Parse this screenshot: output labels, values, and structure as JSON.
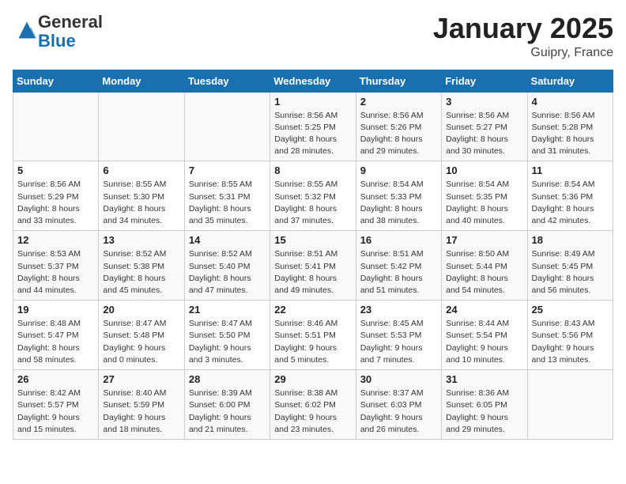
{
  "logo": {
    "general": "General",
    "blue": "Blue"
  },
  "header": {
    "month": "January 2025",
    "location": "Guipry, France"
  },
  "weekdays": [
    "Sunday",
    "Monday",
    "Tuesday",
    "Wednesday",
    "Thursday",
    "Friday",
    "Saturday"
  ],
  "weeks": [
    [
      {
        "day": "",
        "info": ""
      },
      {
        "day": "",
        "info": ""
      },
      {
        "day": "",
        "info": ""
      },
      {
        "day": "1",
        "info": "Sunrise: 8:56 AM\nSunset: 5:25 PM\nDaylight: 8 hours\nand 28 minutes."
      },
      {
        "day": "2",
        "info": "Sunrise: 8:56 AM\nSunset: 5:26 PM\nDaylight: 8 hours\nand 29 minutes."
      },
      {
        "day": "3",
        "info": "Sunrise: 8:56 AM\nSunset: 5:27 PM\nDaylight: 8 hours\nand 30 minutes."
      },
      {
        "day": "4",
        "info": "Sunrise: 8:56 AM\nSunset: 5:28 PM\nDaylight: 8 hours\nand 31 minutes."
      }
    ],
    [
      {
        "day": "5",
        "info": "Sunrise: 8:56 AM\nSunset: 5:29 PM\nDaylight: 8 hours\nand 33 minutes."
      },
      {
        "day": "6",
        "info": "Sunrise: 8:55 AM\nSunset: 5:30 PM\nDaylight: 8 hours\nand 34 minutes."
      },
      {
        "day": "7",
        "info": "Sunrise: 8:55 AM\nSunset: 5:31 PM\nDaylight: 8 hours\nand 35 minutes."
      },
      {
        "day": "8",
        "info": "Sunrise: 8:55 AM\nSunset: 5:32 PM\nDaylight: 8 hours\nand 37 minutes."
      },
      {
        "day": "9",
        "info": "Sunrise: 8:54 AM\nSunset: 5:33 PM\nDaylight: 8 hours\nand 38 minutes."
      },
      {
        "day": "10",
        "info": "Sunrise: 8:54 AM\nSunset: 5:35 PM\nDaylight: 8 hours\nand 40 minutes."
      },
      {
        "day": "11",
        "info": "Sunrise: 8:54 AM\nSunset: 5:36 PM\nDaylight: 8 hours\nand 42 minutes."
      }
    ],
    [
      {
        "day": "12",
        "info": "Sunrise: 8:53 AM\nSunset: 5:37 PM\nDaylight: 8 hours\nand 44 minutes."
      },
      {
        "day": "13",
        "info": "Sunrise: 8:52 AM\nSunset: 5:38 PM\nDaylight: 8 hours\nand 45 minutes."
      },
      {
        "day": "14",
        "info": "Sunrise: 8:52 AM\nSunset: 5:40 PM\nDaylight: 8 hours\nand 47 minutes."
      },
      {
        "day": "15",
        "info": "Sunrise: 8:51 AM\nSunset: 5:41 PM\nDaylight: 8 hours\nand 49 minutes."
      },
      {
        "day": "16",
        "info": "Sunrise: 8:51 AM\nSunset: 5:42 PM\nDaylight: 8 hours\nand 51 minutes."
      },
      {
        "day": "17",
        "info": "Sunrise: 8:50 AM\nSunset: 5:44 PM\nDaylight: 8 hours\nand 54 minutes."
      },
      {
        "day": "18",
        "info": "Sunrise: 8:49 AM\nSunset: 5:45 PM\nDaylight: 8 hours\nand 56 minutes."
      }
    ],
    [
      {
        "day": "19",
        "info": "Sunrise: 8:48 AM\nSunset: 5:47 PM\nDaylight: 8 hours\nand 58 minutes."
      },
      {
        "day": "20",
        "info": "Sunrise: 8:47 AM\nSunset: 5:48 PM\nDaylight: 9 hours\nand 0 minutes."
      },
      {
        "day": "21",
        "info": "Sunrise: 8:47 AM\nSunset: 5:50 PM\nDaylight: 9 hours\nand 3 minutes."
      },
      {
        "day": "22",
        "info": "Sunrise: 8:46 AM\nSunset: 5:51 PM\nDaylight: 9 hours\nand 5 minutes."
      },
      {
        "day": "23",
        "info": "Sunrise: 8:45 AM\nSunset: 5:53 PM\nDaylight: 9 hours\nand 7 minutes."
      },
      {
        "day": "24",
        "info": "Sunrise: 8:44 AM\nSunset: 5:54 PM\nDaylight: 9 hours\nand 10 minutes."
      },
      {
        "day": "25",
        "info": "Sunrise: 8:43 AM\nSunset: 5:56 PM\nDaylight: 9 hours\nand 13 minutes."
      }
    ],
    [
      {
        "day": "26",
        "info": "Sunrise: 8:42 AM\nSunset: 5:57 PM\nDaylight: 9 hours\nand 15 minutes."
      },
      {
        "day": "27",
        "info": "Sunrise: 8:40 AM\nSunset: 5:59 PM\nDaylight: 9 hours\nand 18 minutes."
      },
      {
        "day": "28",
        "info": "Sunrise: 8:39 AM\nSunset: 6:00 PM\nDaylight: 9 hours\nand 21 minutes."
      },
      {
        "day": "29",
        "info": "Sunrise: 8:38 AM\nSunset: 6:02 PM\nDaylight: 9 hours\nand 23 minutes."
      },
      {
        "day": "30",
        "info": "Sunrise: 8:37 AM\nSunset: 6:03 PM\nDaylight: 9 hours\nand 26 minutes."
      },
      {
        "day": "31",
        "info": "Sunrise: 8:36 AM\nSunset: 6:05 PM\nDaylight: 9 hours\nand 29 minutes."
      },
      {
        "day": "",
        "info": ""
      }
    ]
  ]
}
